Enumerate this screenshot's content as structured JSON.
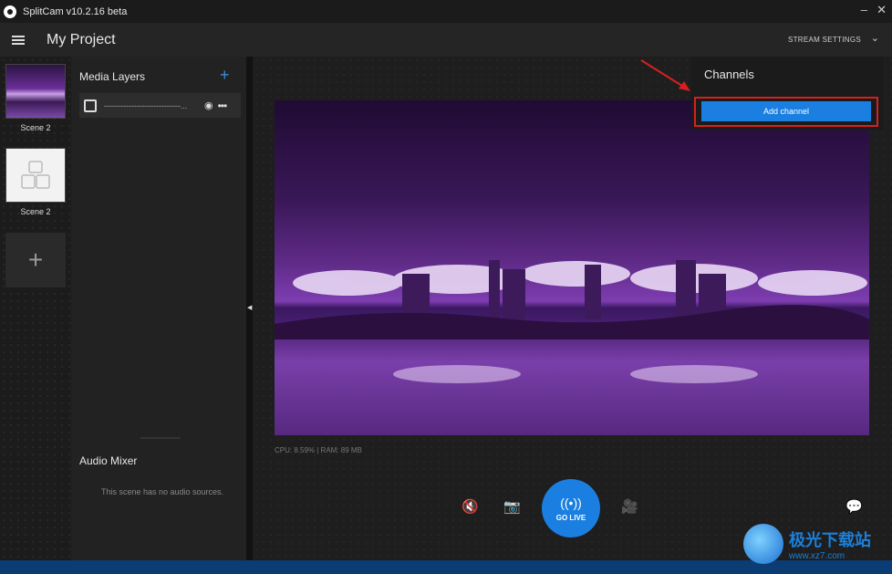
{
  "app": {
    "title": "SplitCam v10.2.16 beta",
    "minimize_glyph": "–",
    "close_glyph": "✕"
  },
  "header": {
    "project_title": "My Project",
    "stream_settings": "STREAM SETTINGS",
    "chevron": "⌄"
  },
  "scenes": [
    {
      "label": "Scene 2"
    },
    {
      "label": "Scene 2"
    }
  ],
  "add_scene_glyph": "+",
  "media_layers": {
    "title": "Media Layers",
    "add_glyph": "+",
    "items": [
      {
        "name": "----------------------------...",
        "icon": "image-icon",
        "visibility_glyph": "◉",
        "menu_glyph": "•••"
      }
    ]
  },
  "audio_mixer": {
    "title": "Audio Mixer",
    "empty_text": "This scene has no audio sources."
  },
  "collapse_glyph": "◀",
  "status": {
    "cpu_ram": "CPU: 8.59% | RAM: 89 MB"
  },
  "controls": {
    "mute_glyph": "🔇",
    "snapshot_glyph": "📷",
    "go_live_wave": "((•))",
    "go_live_label": "GO LIVE",
    "camera_glyph": "🎥",
    "chat_glyph": "💬"
  },
  "channels": {
    "title": "Channels",
    "add_channel_label": "Add channel"
  },
  "watermark": {
    "site_name": "极光下载站",
    "url": "www.xz7.com"
  },
  "colors": {
    "accent_blue": "#1a7fe0",
    "highlight_red": "#d7201e",
    "panel_dark": "#222222"
  }
}
